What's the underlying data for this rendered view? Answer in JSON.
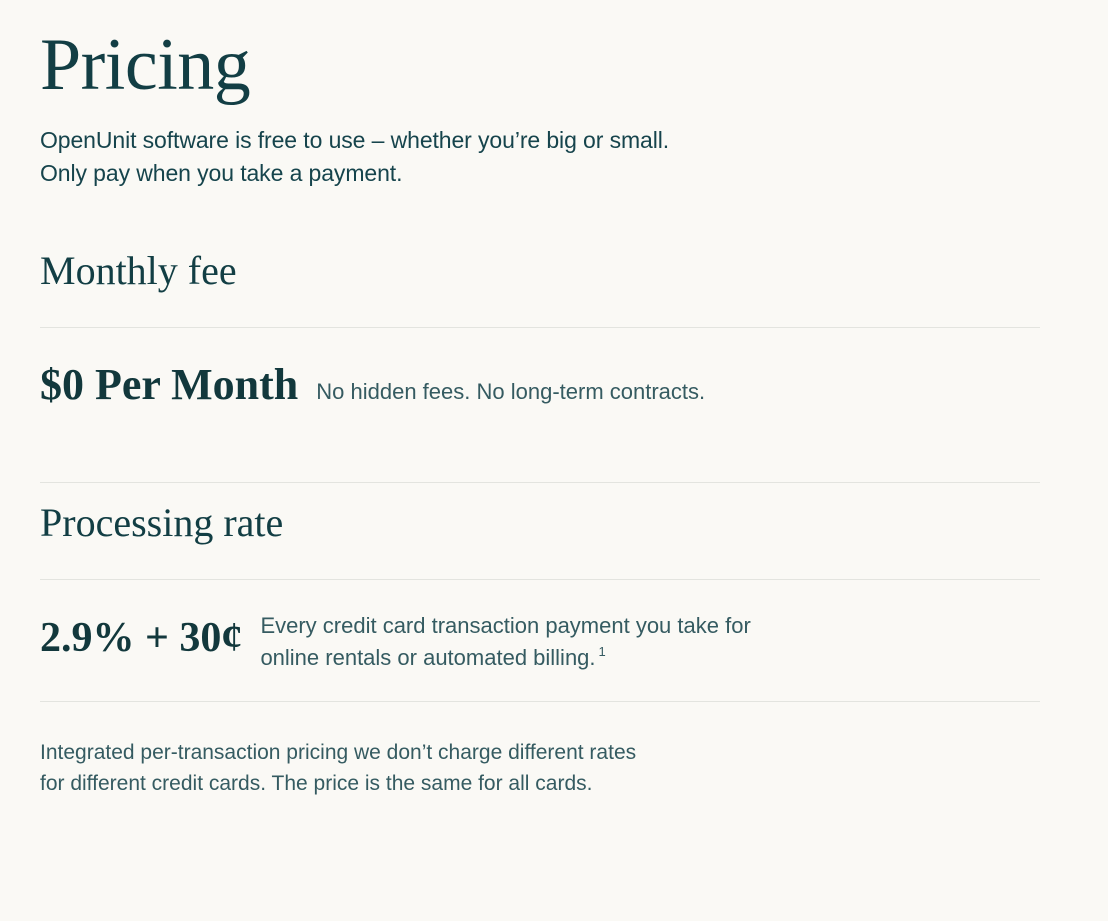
{
  "page": {
    "title": "Pricing",
    "background_color": "#faf9f5",
    "text_color": "#14424a",
    "divider_color": "#e3e4df"
  },
  "hero": {
    "title": "Pricing",
    "subtitle_line_1": "OpenUnit software is free to use – whether you’re big or small.",
    "subtitle_line_2": "Only pay when you take a payment."
  },
  "sections": [
    {
      "heading": "Monthly fee",
      "price": "$0 Per Month",
      "description_line_1": "No hidden fees. No long-term contracts.",
      "description_line_2": ""
    },
    {
      "heading": "Processing rate",
      "price": "2.9% + 30¢",
      "description_line_1": "Every credit card transaction payment you take for",
      "description_line_2": "online rentals or automated billing.",
      "footnote_marker": "1"
    }
  ],
  "closing_note": {
    "line_1": "Integrated per-transaction pricing we don’t charge different rates",
    "line_2": "for different credit cards. The price is the same for all cards."
  }
}
